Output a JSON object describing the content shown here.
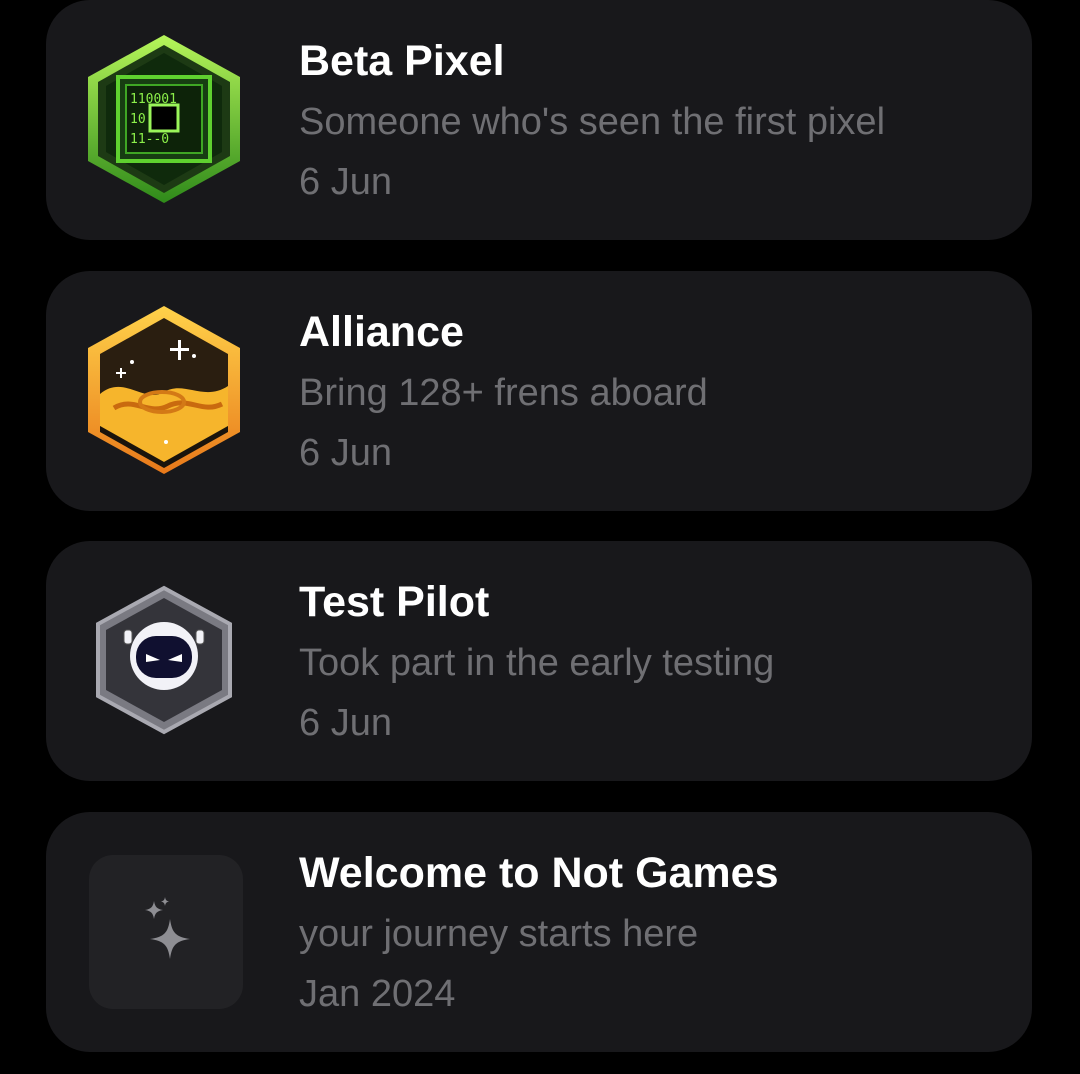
{
  "achievements": [
    {
      "title": "Beta Pixel",
      "description": "Someone who's seen the first pixel",
      "date": "6 Jun",
      "icon": "beta-pixel-badge-icon",
      "accent": "#7dd13a"
    },
    {
      "title": "Alliance",
      "description": "Bring 128+ frens aboard",
      "date": "6 Jun",
      "icon": "alliance-badge-icon",
      "accent": "#f5a623"
    },
    {
      "title": "Test Pilot",
      "description": "Took part in the early testing",
      "date": "6 Jun",
      "icon": "test-pilot-badge-icon",
      "accent": "#8a8a96"
    },
    {
      "title": "Welcome to Not Games",
      "description": "your journey starts here",
      "date": "Jan 2024",
      "icon": "sparkle-icon",
      "accent": "#8e8e93"
    }
  ]
}
